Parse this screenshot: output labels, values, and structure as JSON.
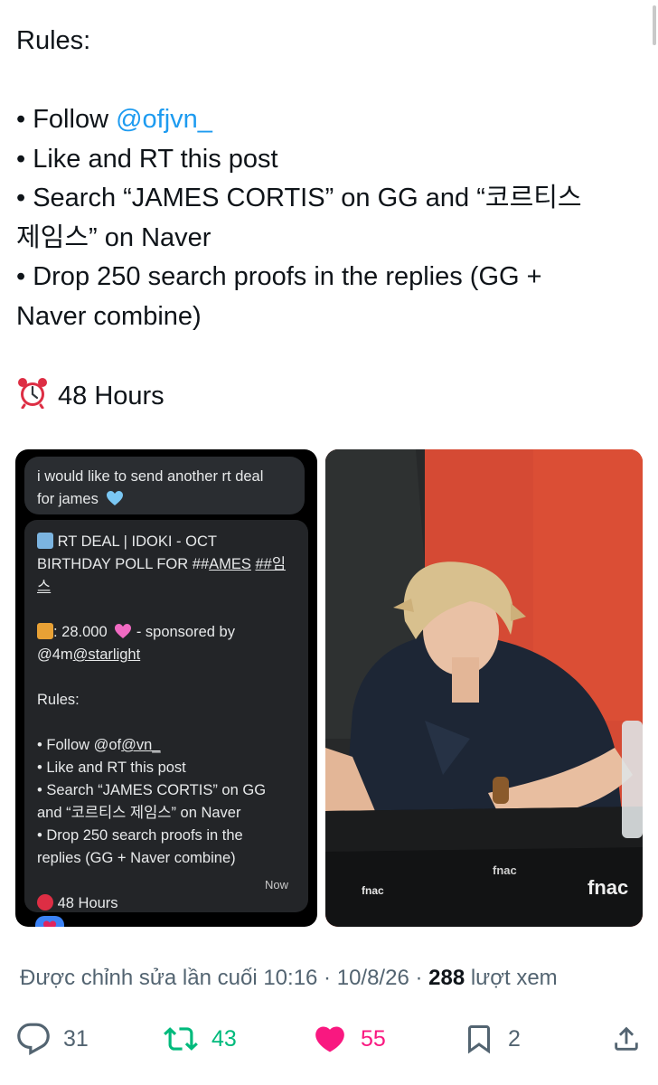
{
  "tweet": {
    "lines": [
      "Rules:",
      "",
      "• Follow ",
      "• Like and RT this post",
      "• Search “JAMES CORTIS” on GG and “코르티스",
      "제임스” on Naver",
      "• Drop 250 search proofs in the replies (GG +",
      "Naver combine)",
      "",
      "48 Hours"
    ],
    "mention": "@ofjvn_"
  },
  "screenshot": {
    "bubble1": [
      "i would like to send another rt deal",
      "for james"
    ],
    "deal_lines": [
      "RT DEAL | IDOKI - OCT",
      "BIRTHDAY POLL FOR ##",
      "AMES",
      "##임",
      "스"
    ],
    "gift_amount": ": 28.000",
    "sponsored": " - sponsored by",
    "sponsor_prefix": "@4m",
    "sponsor_handle": "@starlight",
    "rules_title": "Rules:",
    "rules": [
      "• Follow @of",
      "@vn_",
      "• Like and RT this post",
      "• Search “JAMES CORTIS” on GG",
      "and “코르티스 제임스” on Naver",
      "• Drop 250 search proofs in the",
      "replies (GG + Naver combine)"
    ],
    "hours": "48 Hours",
    "time": "Now"
  },
  "photo": {
    "table_text": [
      "fnac",
      "fnac",
      "fnac"
    ]
  },
  "meta": {
    "edited": "Được chỉnh sửa lần cuối",
    "time": "10:16 · 10/8/26",
    "sep": " · ",
    "views_count": "288",
    "views_label": "lượt xem"
  },
  "actions": {
    "replies": "31",
    "reposts": "43",
    "likes": "55",
    "bookmarks": "2"
  },
  "colors": {
    "mention": "#1d9bf0",
    "repost": "#00ba7c",
    "like": "#f91880",
    "muted": "#536471"
  }
}
